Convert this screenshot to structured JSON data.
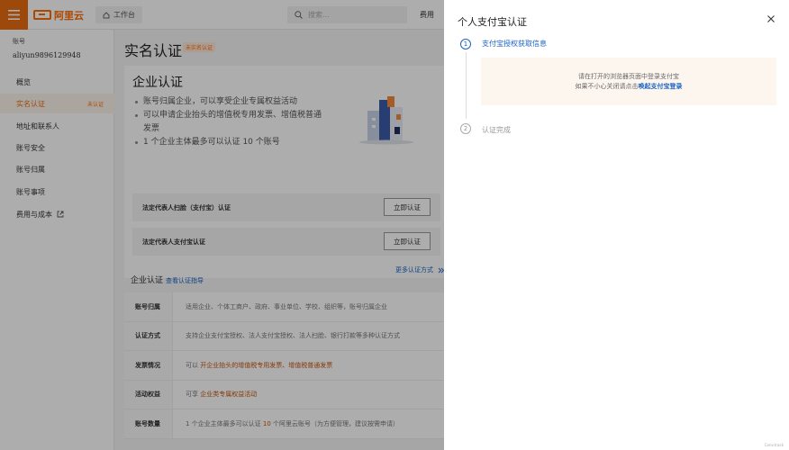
{
  "brand": {
    "logo_text": "阿里云",
    "color": "#ff6a00"
  },
  "topbar": {
    "workbench_label": "工作台",
    "search_placeholder": "搜索...",
    "fee_label": "费用"
  },
  "sidebar": {
    "account_label": "账号",
    "account_name": "aliyun9896129948",
    "items": [
      {
        "label": "概览",
        "active": false
      },
      {
        "label": "实名认证",
        "active": true,
        "badge": "未认证"
      },
      {
        "label": "地址和联系人",
        "active": false
      },
      {
        "label": "账号安全",
        "active": false
      },
      {
        "label": "账号归属",
        "active": false
      },
      {
        "label": "账号事项",
        "active": false
      },
      {
        "label": "费用与成本",
        "active": false,
        "icon": "external-link-icon"
      }
    ]
  },
  "main": {
    "page_title": "实名认证",
    "page_badge": "未实名认证",
    "card": {
      "title": "企业认证",
      "bullets": [
        "账号归属企业，可以享受企业专属权益活动",
        "可以申请企业抬头的增值税专用发票、增值税普通发票",
        "1 个企业主体最多可以认证 10 个账号"
      ],
      "options": [
        {
          "label": "法定代表人扫脸（支付宝）认证",
          "button": "立即认证"
        },
        {
          "label": "法定代表人支付宝认证",
          "button": "立即认证"
        }
      ],
      "more_link": "更多认证方式"
    },
    "guide": {
      "title": "企业认证",
      "link": "查看认证指导"
    },
    "table": [
      {
        "key": "账号归属",
        "pre": "适用企业、个体工商户、政府、事业单位、学校、组织等，账号归属企业",
        "hl": "",
        "post": ""
      },
      {
        "key": "认证方式",
        "pre": "支持企业支付宝授权、法人支付宝授权、法人扫脸、银行打款等多种认证方式",
        "hl": "",
        "post": ""
      },
      {
        "key": "发票情况",
        "pre": "可以 ",
        "hl": "开企业抬头的增值税专用发票、增值税普通发票",
        "post": ""
      },
      {
        "key": "活动权益",
        "pre": "可享 ",
        "hl": "企业类专属权益活动",
        "post": ""
      },
      {
        "key": "账号数量",
        "pre": "1 个企业主体最多可以认证 ",
        "hl": "10",
        "post": " 个阿里云账号（为方便管理，建议按需申请）"
      }
    ]
  },
  "drawer": {
    "title": "个人支付宝认证",
    "steps": [
      {
        "number": "1",
        "label": "支付宝授权获取信息"
      },
      {
        "number": "2",
        "label": "认证完成"
      }
    ],
    "tip_line1": "请在打开的浏览器页面中登录支付宝",
    "tip_line2_pre": "如果不小心关闭请点击",
    "tip_link": "唤起支付宝登录",
    "accent": "#1b63c4"
  },
  "corner_text": "Conv.track"
}
